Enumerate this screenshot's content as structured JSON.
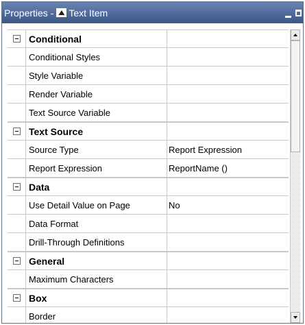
{
  "titlebar": {
    "label": "Properties - ",
    "item_label": "Text Item",
    "object_icon": "text-item-icon",
    "minimize_icon": "minimize-icon",
    "maximize_icon": "maximize-icon"
  },
  "categories": [
    {
      "name": "Conditional",
      "properties": [
        {
          "name": "Conditional Styles",
          "value": ""
        },
        {
          "name": "Style Variable",
          "value": ""
        },
        {
          "name": "Render Variable",
          "value": ""
        },
        {
          "name": "Text Source Variable",
          "value": ""
        }
      ]
    },
    {
      "name": "Text Source",
      "properties": [
        {
          "name": "Source Type",
          "value": "Report Expression"
        },
        {
          "name": "Report Expression",
          "value": "ReportName ()"
        }
      ]
    },
    {
      "name": "Data",
      "properties": [
        {
          "name": "Use Detail Value on Page",
          "value": "No"
        },
        {
          "name": "Data Format",
          "value": ""
        },
        {
          "name": "Drill-Through Definitions",
          "value": ""
        }
      ]
    },
    {
      "name": "General",
      "properties": [
        {
          "name": "Maximum Characters",
          "value": ""
        }
      ]
    },
    {
      "name": "Box",
      "properties": [
        {
          "name": "Border",
          "value": ""
        }
      ]
    }
  ],
  "colors": {
    "titlebar": "#3b5786",
    "gridline": "#c8c8c8"
  }
}
